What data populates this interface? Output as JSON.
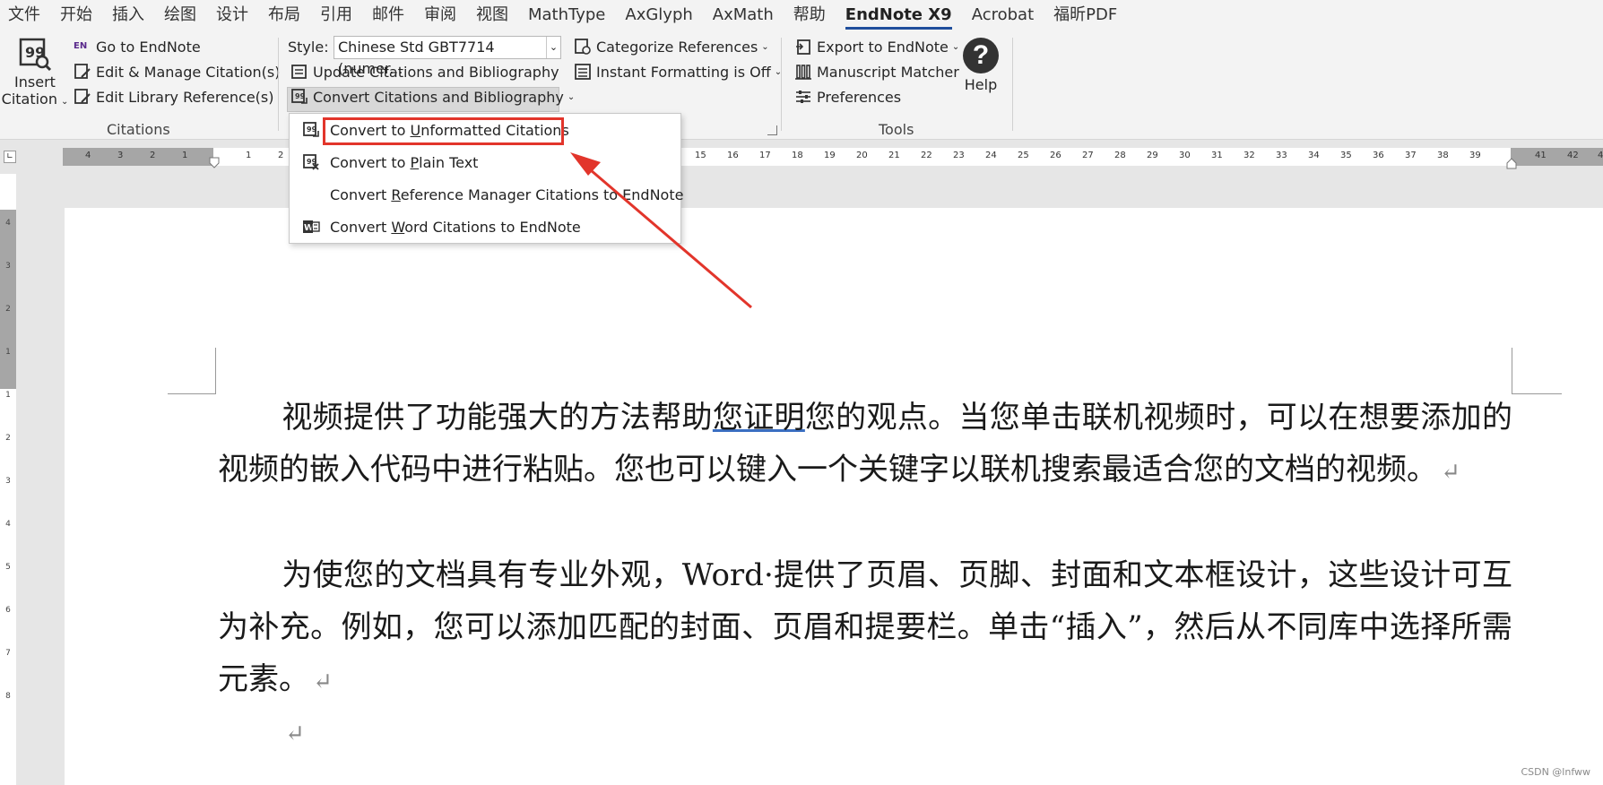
{
  "tabs": [
    "文件",
    "开始",
    "插入",
    "绘图",
    "设计",
    "布局",
    "引用",
    "邮件",
    "审阅",
    "视图",
    "MathType",
    "AxGlyph",
    "AxMath",
    "帮助",
    "EndNote X9",
    "Acrobat",
    "福昕PDF"
  ],
  "active_tab": "EndNote X9",
  "ribbon": {
    "citations_group": {
      "insert_citation_line1": "Insert",
      "insert_citation_line2": "Citation",
      "go_to_endnote": "Go to EndNote",
      "edit_manage": "Edit & Manage Citation(s)",
      "edit_library": "Edit Library Reference(s)",
      "label": "Citations"
    },
    "bibliography_group": {
      "style_label": "Style:",
      "style_value": "Chinese Std GBT7714 (numer...",
      "update": "Update Citations and Bibliography",
      "convert": "Convert Citations and Bibliography",
      "categorize": "Categorize References",
      "instant": "Instant Formatting is Off"
    },
    "tools_group": {
      "export": "Export to EndNote",
      "matcher": "Manuscript Matcher",
      "preferences": "Preferences",
      "help": "Help",
      "label": "Tools"
    }
  },
  "menu": {
    "items": [
      {
        "pre": "Convert to ",
        "u": "U",
        "post": "nformatted Citations"
      },
      {
        "pre": "Convert to ",
        "u": "P",
        "post": "lain Text"
      },
      {
        "pre": "Convert ",
        "u": "R",
        "post": "eference Manager Citations to EndNote"
      },
      {
        "pre": "Convert ",
        "u": "W",
        "post": "ord Citations to EndNote"
      }
    ]
  },
  "ruler": {
    "left_ticks": [
      "4",
      "3",
      "2",
      "1"
    ],
    "right_ticks": [
      "1",
      "2",
      "15",
      "16",
      "17",
      "18",
      "19",
      "20",
      "21",
      "22",
      "23",
      "24",
      "25",
      "26",
      "27",
      "28",
      "29",
      "30",
      "31",
      "32",
      "33",
      "34",
      "35",
      "36",
      "37",
      "38",
      "39",
      "41",
      "42",
      "4"
    ],
    "vertical": [
      "4",
      "3",
      "2",
      "1",
      "1",
      "2",
      "3",
      "4",
      "5",
      "6",
      "7",
      "8"
    ]
  },
  "document": {
    "p1_a": "视频提供了功能强大的方法帮助",
    "p1_u": "您证明",
    "p1_b": "您的观点。当您单击联机视频时，可以在想要添加的视频的嵌入代码中进行粘贴。您也可以键入一个关键字以联机搜索最适合您的文档的视频。",
    "p2": "为使您的文档具有专业外观，Word·提供了页眉、页脚、封面和文本框设计，这些设计可互为补充。例如，您可以添加匹配的封面、页眉和提要栏。单击“插入”，然后从不同库中选择所需元素。",
    "return_mark": "↵"
  },
  "watermark": "CSDN @lnfww",
  "colors": {
    "highlight": "#e2352b",
    "active_tab_underline": "#1f4e9c",
    "ribbon_bg": "#f3f3f3"
  }
}
